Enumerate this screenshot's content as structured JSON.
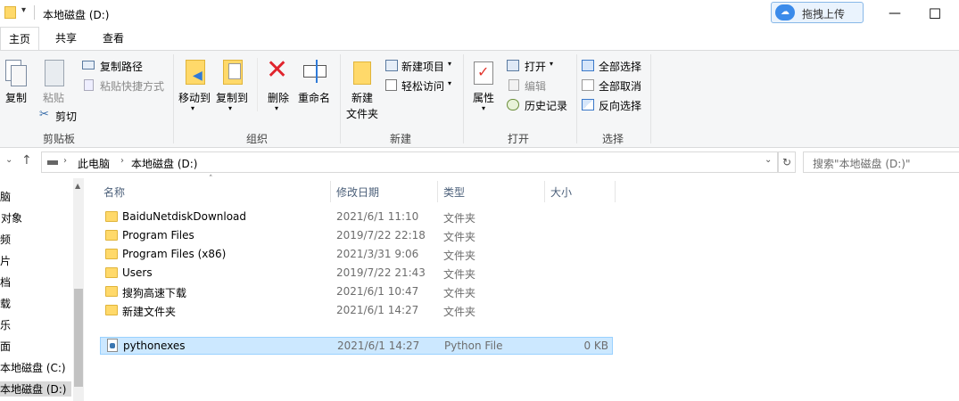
{
  "window": {
    "title": "本地磁盘 (D:)",
    "baidu_button": "拖拽上传",
    "minimize": "—",
    "maximize": "☐"
  },
  "tabs": [
    "主页",
    "共享",
    "查看"
  ],
  "ribbon": {
    "clipboard": {
      "copy": "复制",
      "paste": "粘贴",
      "copy_path": "复制路径",
      "paste_shortcut": "粘贴快捷方式",
      "cut": "剪切",
      "label": "剪贴板"
    },
    "organize": {
      "move_to": "移动到",
      "copy_to": "复制到",
      "delete": "删除",
      "rename": "重命名",
      "label": "组织"
    },
    "new": {
      "new_folder_line1": "新建",
      "new_folder_line2": "文件夹",
      "new_item": "新建项目",
      "easy_access": "轻松访问",
      "label": "新建"
    },
    "open": {
      "properties": "属性",
      "open": "打开",
      "edit": "编辑",
      "history": "历史记录",
      "label": "打开"
    },
    "select": {
      "select_all": "全部选择",
      "select_none": "全部取消",
      "invert": "反向选择",
      "label": "选择"
    }
  },
  "address": {
    "crumbs": [
      "此电脑",
      "本地磁盘 (D:)"
    ],
    "search_placeholder": "搜索\"本地磁盘 (D:)\""
  },
  "nav_items": [
    "电脑",
    "D 对象",
    "视频",
    "图片",
    "文档",
    "下载",
    "音乐",
    "桌面",
    "本地磁盘 (C:)",
    "本地磁盘 (D:)"
  ],
  "columns": {
    "name": "名称",
    "date": "修改日期",
    "type": "类型",
    "size": "大小"
  },
  "files": [
    {
      "name": "BaiduNetdiskDownload",
      "date": "2021/6/1 11:10",
      "type": "文件夹",
      "size": "",
      "kind": "folder"
    },
    {
      "name": "Program Files",
      "date": "2019/7/22 22:18",
      "type": "文件夹",
      "size": "",
      "kind": "folder"
    },
    {
      "name": "Program Files (x86)",
      "date": "2021/3/31 9:06",
      "type": "文件夹",
      "size": "",
      "kind": "folder"
    },
    {
      "name": "Users",
      "date": "2019/7/22 21:43",
      "type": "文件夹",
      "size": "",
      "kind": "folder"
    },
    {
      "name": "搜狗高速下载",
      "date": "2021/6/1 10:47",
      "type": "文件夹",
      "size": "",
      "kind": "folder"
    },
    {
      "name": "新建文件夹",
      "date": "2021/6/1 14:27",
      "type": "文件夹",
      "size": "",
      "kind": "folder"
    },
    {
      "name": "pythonexes",
      "date": "2021/6/1 14:27",
      "type": "Python File",
      "size": "0 KB",
      "kind": "python",
      "selected": true
    }
  ]
}
